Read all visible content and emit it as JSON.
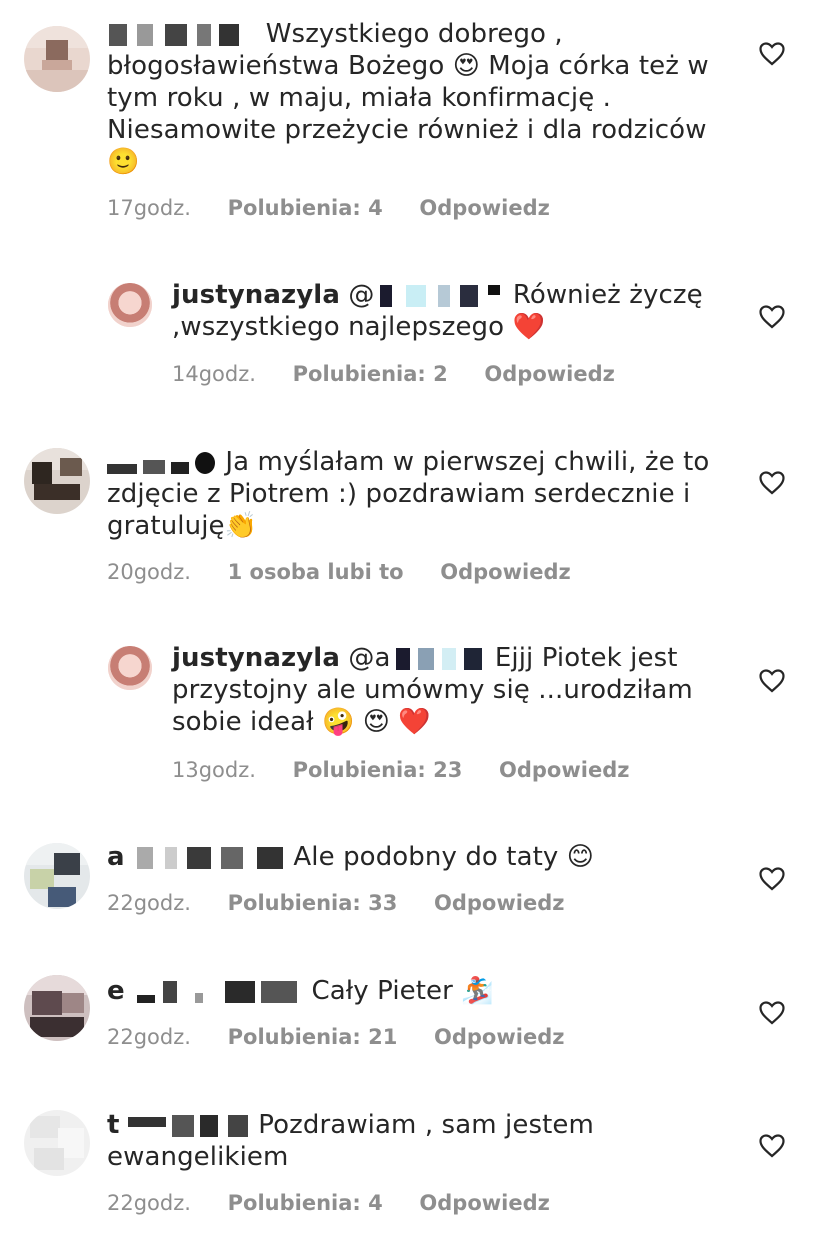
{
  "comments": [
    {
      "username": "",
      "text": "Wszystkiego dobrego , błogosławieństwa Bożego 😍 Moja córka też w tym roku ,  w maju, miała konfirmację . Niesamowite przeżycie również i dla rodziców 🙂",
      "time": "17godz.",
      "likes": "Polubienia: 4",
      "reply": "Odpowiedz"
    },
    {
      "username": "justynazyla",
      "mention": "@",
      "text": " Również życzę ,wszystkiego najlepszego ❤️",
      "time": "14godz.",
      "likes": "Polubienia: 2",
      "reply": "Odpowiedz"
    },
    {
      "username": "",
      "text": "Ja myślałam w pierwszej chwili, że to zdjęcie z Piotrem :) pozdrawiam serdecznie i gratuluję👏",
      "time": "20godz.",
      "likes": "1 osoba lubi to",
      "reply": "Odpowiedz"
    },
    {
      "username": "justynazyla",
      "mention": "@a",
      "text": " Ejjj Piotek jest przystojny ale umówmy się ...urodziłam sobie ideał 🤪 😍 ❤️",
      "time": "13godz.",
      "likes": "Polubienia: 23",
      "reply": "Odpowiedz"
    },
    {
      "username": "a",
      "text": "Ale podobny do taty 😊",
      "time": "22godz.",
      "likes": "Polubienia: 33",
      "reply": "Odpowiedz"
    },
    {
      "username": "e",
      "text": "Cały Pieter 🏂",
      "time": "22godz.",
      "likes": "Polubienia: 21",
      "reply": "Odpowiedz"
    },
    {
      "username": "t",
      "text": "Pozdrawiam , sam jestem ewangelikiem",
      "time": "22godz.",
      "likes": "Polubienia: 4",
      "reply": "Odpowiedz"
    }
  ],
  "icons": {
    "like": "heart-outline-icon"
  },
  "colors": {
    "meta": "#8e8e8e",
    "text": "#262626"
  }
}
